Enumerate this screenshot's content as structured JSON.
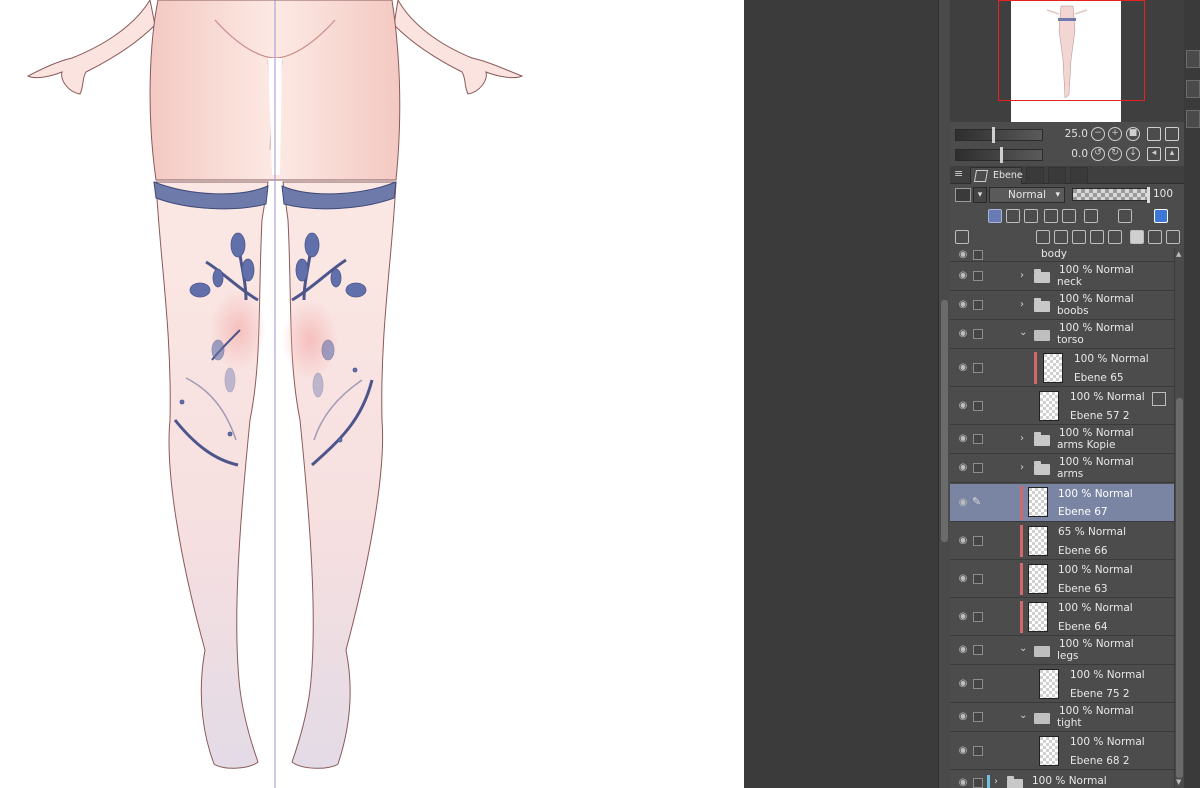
{
  "navigator": {
    "zoom_value": "25.0",
    "rotation_value": "0.0"
  },
  "layer_panel": {
    "tab_label": "Ebene",
    "blend_mode": "Normal",
    "opacity_value": "100",
    "group_title": "body",
    "layers": [
      {
        "l1": "100 % Normal",
        "l2": "neck",
        "kind": "folder",
        "collapsed": true
      },
      {
        "l1": "100 % Normal",
        "l2": "boobs",
        "kind": "folder",
        "collapsed": true
      },
      {
        "l1": "100 % Normal",
        "l2": "torso",
        "kind": "folder",
        "collapsed": false
      },
      {
        "l1": "100 % Normal",
        "l2": "Ebene 65",
        "kind": "raster"
      },
      {
        "l1": "100 % Normal",
        "l2": "Ebene 57 2",
        "kind": "raster"
      },
      {
        "l1": "100 % Normal",
        "l2": "arms Kopie",
        "kind": "folder",
        "collapsed": true
      },
      {
        "l1": "100 % Normal",
        "l2": "arms",
        "kind": "folder",
        "collapsed": true
      },
      {
        "l1": "100 % Normal",
        "l2": "Ebene 67",
        "kind": "raster",
        "selected": true
      },
      {
        "l1": "65 % Normal",
        "l2": "Ebene 66",
        "kind": "raster"
      },
      {
        "l1": "100 % Normal",
        "l2": "Ebene 63",
        "kind": "raster"
      },
      {
        "l1": "100 % Normal",
        "l2": "Ebene 64",
        "kind": "raster"
      },
      {
        "l1": "100 % Normal",
        "l2": "legs",
        "kind": "folder",
        "collapsed": false
      },
      {
        "l1": "100 % Normal",
        "l2": "Ebene 75 2",
        "kind": "raster"
      },
      {
        "l1": "100 % Normal",
        "l2": "tight",
        "kind": "folder",
        "collapsed": false
      },
      {
        "l1": "100 % Normal",
        "l2": "Ebene 68 2",
        "kind": "raster"
      },
      {
        "l1": "100 % Normal",
        "l2": "",
        "kind": "folder",
        "collapsed": true
      }
    ]
  },
  "colors": {
    "skin": "#f6dcd6",
    "stocking": "#f3e2e4",
    "band": "#6e7aaa",
    "floral": "#5567a6",
    "selection": "#7a85a3",
    "nav_frame": "#e52121"
  }
}
